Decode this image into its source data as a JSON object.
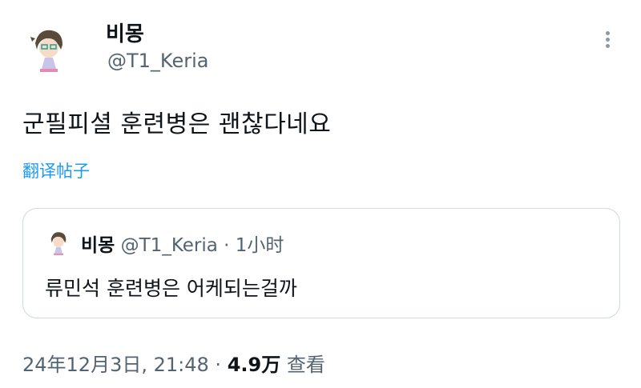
{
  "author": {
    "display_name": "비몽",
    "handle": "@T1_Keria"
  },
  "tweet": {
    "text": "군필피셜 훈련병은 괜찮다네요",
    "translate_label": "翻译帖子"
  },
  "quoted_tweet": {
    "display_name": "비몽",
    "handle": "@T1_Keria",
    "separator": "·",
    "time": "1小时",
    "text": "류민석 훈련병은 어케되는걸까"
  },
  "meta": {
    "timestamp": "24年12月3日, 21:48",
    "separator": "·",
    "views_count": "4.9万",
    "views_label": "查看"
  },
  "icons": {
    "more": "more-vertical-icon"
  },
  "colors": {
    "link": "#1d9bf0",
    "secondary_text": "#536471",
    "border": "#cfd9de"
  }
}
